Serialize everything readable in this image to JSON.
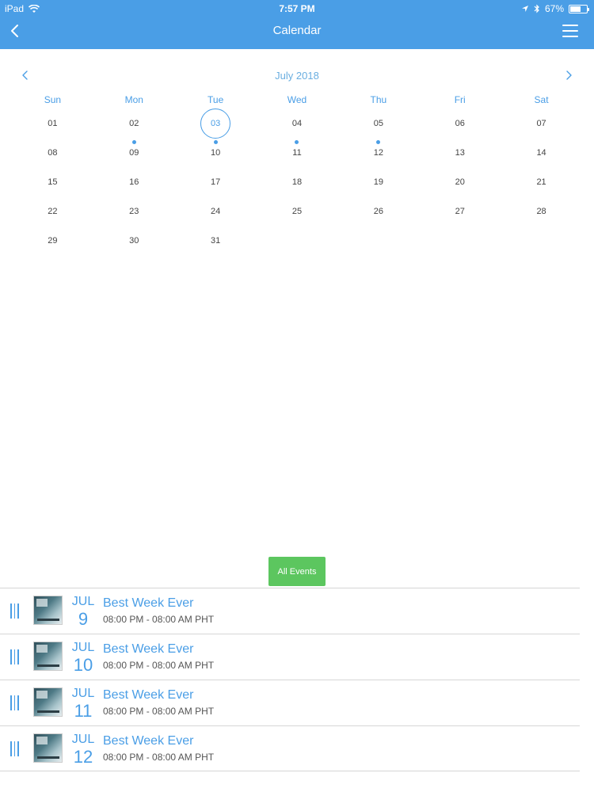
{
  "status_bar": {
    "device": "iPad",
    "time": "7:57 PM",
    "battery": "67%",
    "battery_level": 0.67
  },
  "header": {
    "title": "Calendar",
    "back_icon": "chevron-left-icon",
    "menu_icon": "hamburger-icon"
  },
  "calendar": {
    "month_label": "July 2018",
    "weekdays": [
      "Sun",
      "Mon",
      "Tue",
      "Wed",
      "Thu",
      "Fri",
      "Sat"
    ],
    "days": [
      "01",
      "02",
      "03",
      "04",
      "05",
      "06",
      "07",
      "08",
      "09",
      "10",
      "11",
      "12",
      "13",
      "14",
      "15",
      "16",
      "17",
      "18",
      "19",
      "20",
      "21",
      "22",
      "23",
      "24",
      "25",
      "26",
      "27",
      "28",
      "29",
      "30",
      "31"
    ],
    "selected_day": "03",
    "event_days": [
      "02",
      "03",
      "04",
      "05"
    ]
  },
  "all_events_label": "All Events",
  "events": [
    {
      "month": "JUL",
      "day": "9",
      "title": "Best Week Ever",
      "time": "08:00 PM - 08:00 AM PHT"
    },
    {
      "month": "JUL",
      "day": "10",
      "title": "Best Week Ever",
      "time": "08:00 PM - 08:00 AM PHT"
    },
    {
      "month": "JUL",
      "day": "11",
      "title": "Best Week Ever",
      "time": "08:00 PM - 08:00 AM PHT"
    },
    {
      "month": "JUL",
      "day": "12",
      "title": "Best Week Ever",
      "time": "08:00 PM - 08:00 AM PHT"
    }
  ],
  "colors": {
    "accent": "#4a9ee6",
    "button": "#5cc65f"
  }
}
